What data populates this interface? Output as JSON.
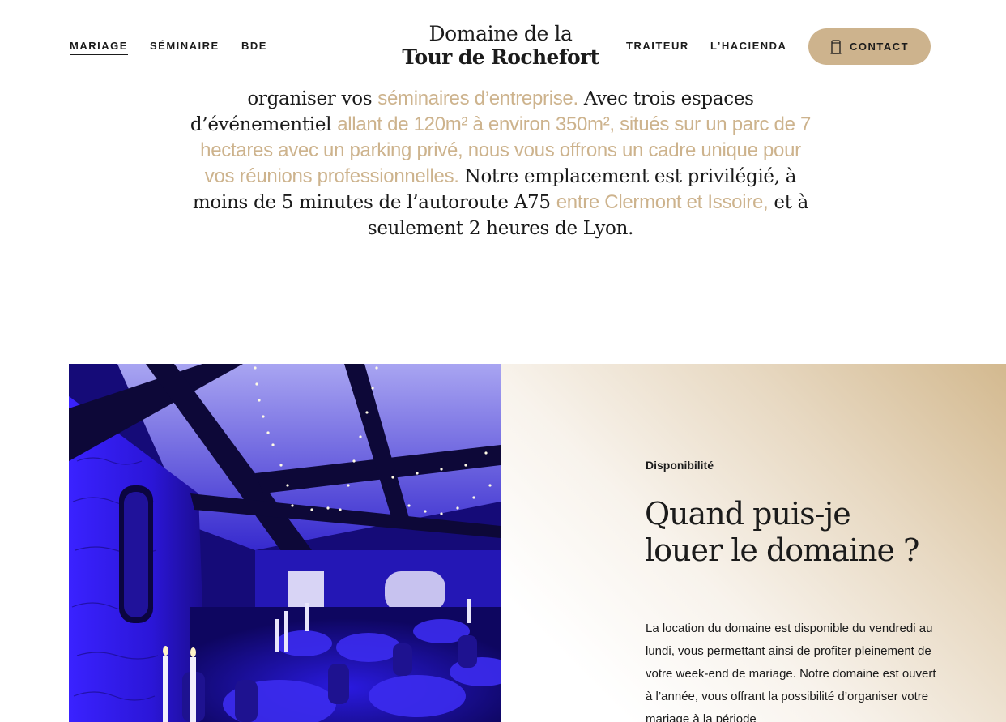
{
  "nav": {
    "left": [
      {
        "label": "MARIAGE",
        "active": true
      },
      {
        "label": "SÉMINAIRE",
        "active": false
      },
      {
        "label": "BDE",
        "active": false
      }
    ],
    "right": [
      {
        "label": "TRAITEUR"
      },
      {
        "label": "L’HACIENDA"
      }
    ],
    "contact_label": "CONTACT",
    "contact_icon": "door-icon"
  },
  "logo": {
    "line1": "Domaine de la",
    "line2": "Tour de Rochefort"
  },
  "intro": {
    "t1": "organiser vos ",
    "h1": "séminaires d’entreprise.",
    "t2": " Avec trois espaces d’événementiel ",
    "h2": "allant de 120m² à environ 350m², situés sur un parc de 7 hectares avec un parking privé, nous vous offrons un cadre unique pour vos réunions professionnelles.",
    "t3": " Notre emplacement est privilégié, à moins de 5 minutes de l’autoroute A75 ",
    "h3": "entre Clermont et Issoire,",
    "t4": " et à seulement 2 heures de Lyon."
  },
  "availability": {
    "eyebrow": "Disponibilité",
    "heading_line1": "Quand puis-je",
    "heading_line2": "louer le domaine ?",
    "body": "La location du domaine est disponible du vendredi au lundi, vous permettant ainsi de profiter pleinement de votre week-end de mariage. Notre domaine est ouvert à l’année, vous offrant la possibilité d’organiser votre mariage à la période"
  },
  "colors": {
    "accent": "#cdb38d",
    "text": "#1b1b1b",
    "photo_light": "#2a16ff"
  }
}
